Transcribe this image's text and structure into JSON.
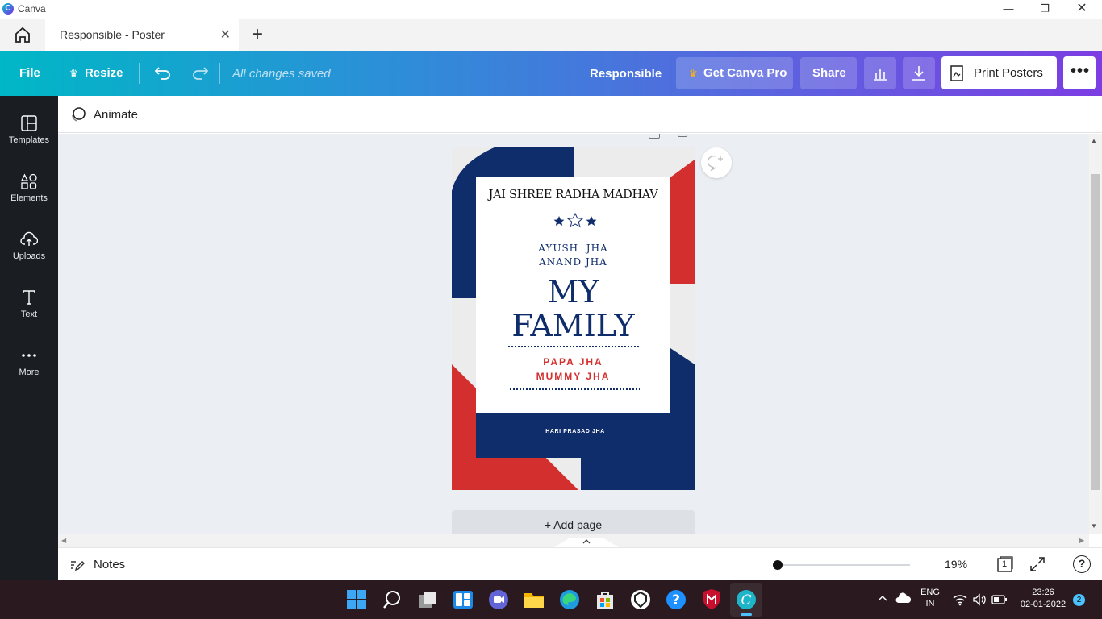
{
  "window": {
    "app_title": "Canva"
  },
  "tabs": {
    "active_label": "Responsible - Poster"
  },
  "toolbar": {
    "file": "File",
    "resize": "Resize",
    "save_status": "All changes saved",
    "doc_name": "Responsible",
    "get_pro": "Get Canva Pro",
    "share": "Share",
    "print": "Print Posters"
  },
  "sidebar": {
    "items": [
      {
        "label": "Templates"
      },
      {
        "label": "Elements"
      },
      {
        "label": "Uploads"
      },
      {
        "label": "Text"
      },
      {
        "label": "More"
      }
    ]
  },
  "animate": {
    "label": "Animate"
  },
  "poster": {
    "header": "JAI SHREE RADHA MADHAV",
    "names_line1": "AYUSH  JHA",
    "names_line2": "ANAND JHA",
    "title_line1": "MY",
    "title_line2": "FAMILY",
    "parents_line1": "PAPA JHA",
    "parents_line2": "MUMMY JHA",
    "footer": "HARI PRASAD JHA",
    "colors": {
      "navy": "#0f2d6b",
      "red": "#d32f2f",
      "light": "#ececec"
    }
  },
  "canvas": {
    "add_page": "+ Add page"
  },
  "bottom": {
    "notes": "Notes",
    "zoom": "19%",
    "page_count": "1",
    "zoom_level": 0.19
  },
  "taskbar": {
    "lang_line1": "ENG",
    "lang_line2": "IN",
    "time": "23:26",
    "date": "02-01-2022",
    "notifications": "2"
  }
}
